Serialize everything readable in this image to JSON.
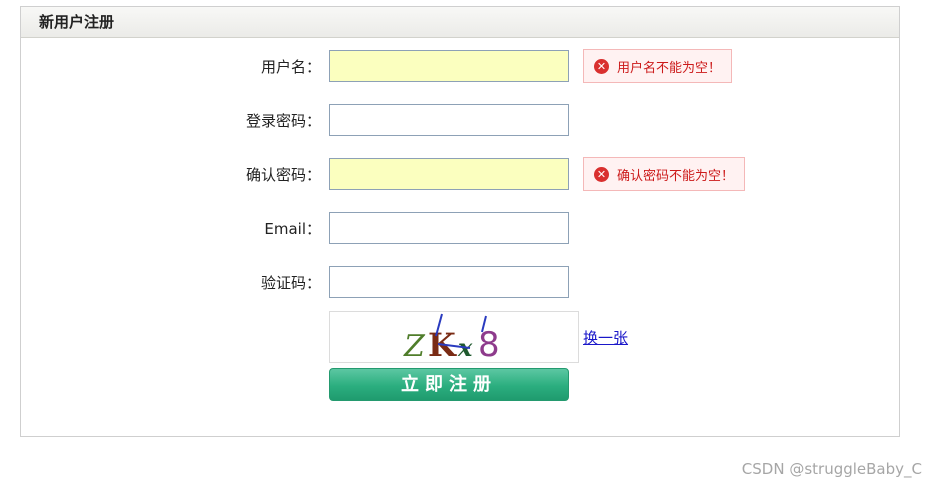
{
  "panel": {
    "title": "新用户注册"
  },
  "form": {
    "fields": [
      {
        "label": "用户名：",
        "value": "",
        "state": "error",
        "error": "用户名不能为空！"
      },
      {
        "label": "登录密码：",
        "value": "",
        "state": "normal"
      },
      {
        "label": "确认密码：",
        "value": "",
        "state": "error",
        "error": "确认密码不能为空！"
      },
      {
        "label": "Email：",
        "value": "",
        "state": "normal"
      },
      {
        "label": "验证码：",
        "value": "",
        "state": "normal"
      }
    ],
    "captcha": {
      "text": "ZKx8",
      "chars": [
        "Z",
        "K",
        "x",
        "8"
      ],
      "refresh_label": "换一张"
    },
    "submit_label": "立即注册"
  },
  "icons": {
    "error": "error-circle-x-icon"
  },
  "colors": {
    "error_field_bg": "#fbffbf",
    "error_text": "#cc1a1a",
    "submit_green": "#2bae7f",
    "link_blue": "#1a17c9"
  },
  "watermark": "CSDN @struggleBaby_C"
}
